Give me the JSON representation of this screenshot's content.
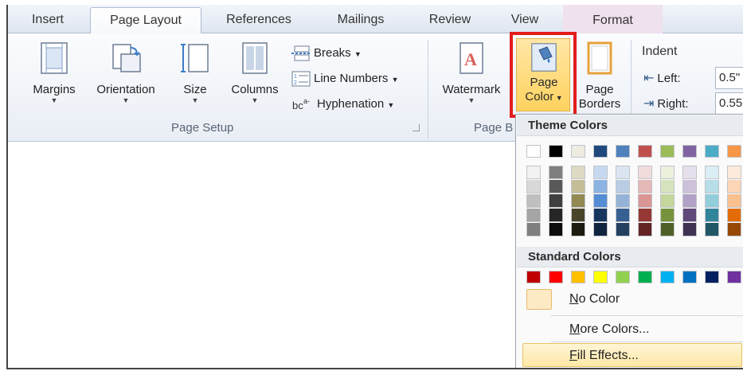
{
  "tabs": {
    "insert": "Insert",
    "page_layout": "Page Layout",
    "references": "References",
    "mailings": "Mailings",
    "review": "Review",
    "view": "View",
    "format": "Format"
  },
  "page_setup": {
    "margins": "Margins",
    "orientation": "Orientation",
    "size": "Size",
    "columns": "Columns",
    "breaks": "Breaks",
    "line_numbers": "Line Numbers",
    "hyphenation": "Hyphenation",
    "group_label": "Page Setup"
  },
  "page_background": {
    "watermark": "Watermark",
    "page_color_line1": "Page",
    "page_color_line2": "Color",
    "page_borders_line1": "Page",
    "page_borders_line2": "Borders",
    "group_label": "Page B"
  },
  "paragraph": {
    "indent": "Indent",
    "left_label": "Left:",
    "left_value": "0.5\"",
    "right_label": "Right:",
    "right_value": "0.55"
  },
  "menu": {
    "theme_colors": "Theme Colors",
    "standard_colors": "Standard Colors",
    "no_color_prefix": "N",
    "no_color_rest": "o Color",
    "more_colors_prefix": "M",
    "more_colors_rest": "ore Colors...",
    "fill_effects_prefix": "F",
    "fill_effects_rest": "ill Effects..."
  },
  "colors": {
    "theme_top": [
      "#ffffff",
      "#000000",
      "#eeece1",
      "#1f497d",
      "#4f81bd",
      "#c0504d",
      "#9bbb59",
      "#8064a2",
      "#4bacc6",
      "#f79646"
    ],
    "theme_shades": [
      [
        "#f2f2f2",
        "#7f7f7f",
        "#ddd9c3",
        "#c6d9f0",
        "#dbe5f1",
        "#f2dcdb",
        "#ebf1dd",
        "#e5e0ec",
        "#dbeef3",
        "#fdeada"
      ],
      [
        "#d8d8d8",
        "#595959",
        "#c4bd97",
        "#8db3e2",
        "#b8cce4",
        "#e5b9b7",
        "#d7e3bc",
        "#ccc1d9",
        "#b7dde8",
        "#fbd5b5"
      ],
      [
        "#bfbfbf",
        "#3f3f3f",
        "#938953",
        "#548dd4",
        "#95b3d7",
        "#d99694",
        "#c3d69b",
        "#b2a2c7",
        "#92cddc",
        "#fac08f"
      ],
      [
        "#a5a5a5",
        "#262626",
        "#494429",
        "#17365d",
        "#366092",
        "#953734",
        "#76923c",
        "#5f497a",
        "#31859b",
        "#e36c09"
      ],
      [
        "#7f7f7f",
        "#0c0c0c",
        "#1d1b10",
        "#0f243e",
        "#244061",
        "#632423",
        "#4f6128",
        "#3f3151",
        "#205867",
        "#974806"
      ]
    ],
    "standard": [
      "#c00000",
      "#ff0000",
      "#ffc000",
      "#ffff00",
      "#92d050",
      "#00b050",
      "#00b0f0",
      "#0070c0",
      "#002060",
      "#7030a0"
    ],
    "highlight": "#e31c1c",
    "hover": "#ffe8a6"
  }
}
